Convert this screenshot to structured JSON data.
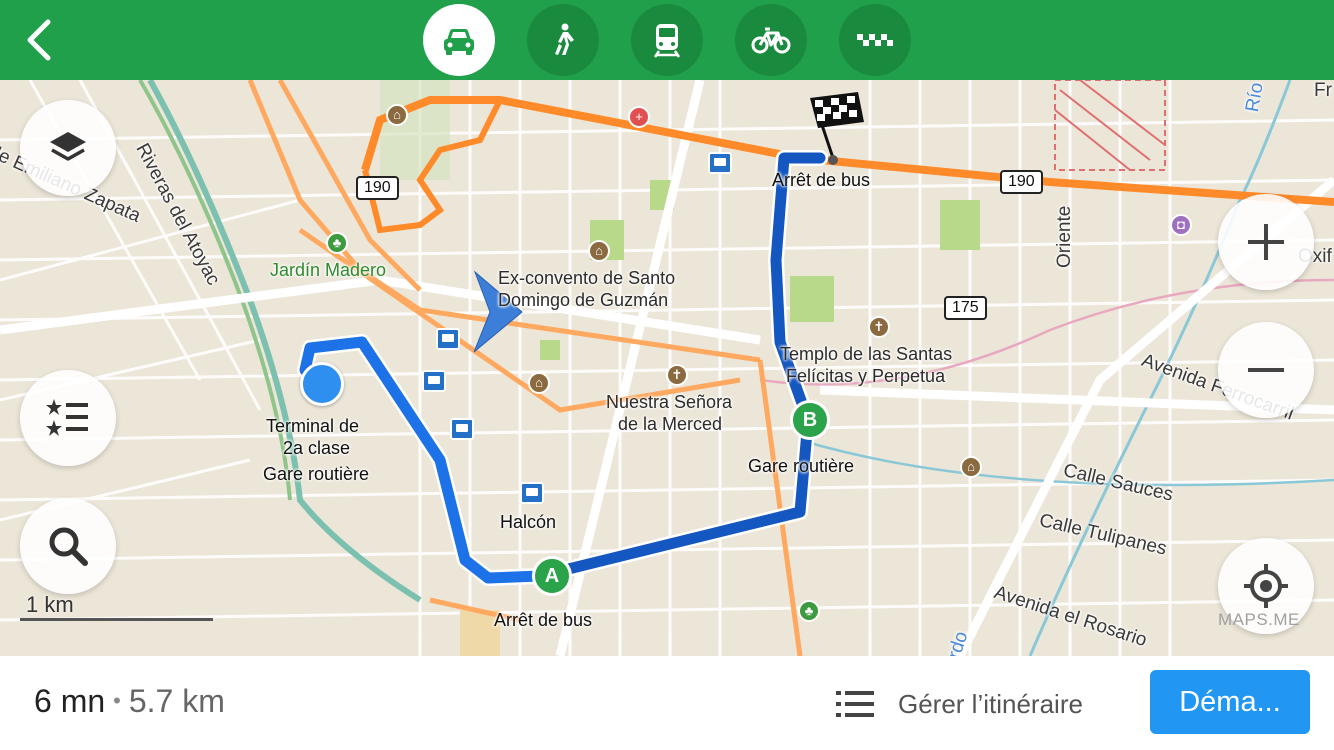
{
  "topbar": {
    "color": "#20a04a",
    "back_icon": "chevron-left-icon",
    "modes": [
      {
        "icon": "car-icon",
        "selected": true
      },
      {
        "icon": "walk-icon",
        "selected": false
      },
      {
        "icon": "train-icon",
        "selected": false
      },
      {
        "icon": "bicycle-icon",
        "selected": false
      },
      {
        "icon": "taxi-icon",
        "selected": false
      }
    ]
  },
  "map": {
    "streets": {
      "riveras": "Riveras del Atoyac",
      "emiliano": "lle Emiliano Zapata",
      "oriente": "Oriente",
      "rio": "Río",
      "fr": "Fr",
      "oxif": "Oxif",
      "ferrocarril": "Avenida Ferrocarril",
      "sauces": "Calle Sauces",
      "tulipanes": "Calle Tulipanes",
      "rosario": "Avenida el Rosario",
      "rdo": "rdo"
    },
    "road_shields": {
      "r190a": "190",
      "r190b": "190",
      "r175": "175"
    },
    "places": {
      "jardin": "Jardín Madero",
      "convento_1": "Ex-convento de Santo",
      "convento_2": "Domingo de Guzmán",
      "templo_1": "Templo de las Santas",
      "templo_2": "Felícitas y Perpetua",
      "merced_1": "Nuestra Señora",
      "merced_2": "de la Merced",
      "terminal_1": "Terminal de",
      "terminal_2": "2a clase",
      "terminal_3": "Gare routière",
      "halcon": "Halcón",
      "arret_top": "Arrêt de bus",
      "arret_bottom": "Arrêt de bus",
      "gare_b": "Gare routière"
    },
    "route_points": {
      "a": "A",
      "b": "B"
    },
    "route_color": "#1d72e8",
    "route_color_transit": "#1557c0",
    "highway_color": "#ff8a2a",
    "scale_label": "1 km",
    "watermark": "MAPS.ME",
    "controls": [
      "layers-icon",
      "bookmarks-icon",
      "search-icon",
      "zoom-in-icon",
      "zoom-out-icon",
      "my-location-icon"
    ]
  },
  "bottombar": {
    "eta_time": "6 mn",
    "eta_separator": "•",
    "eta_distance": "5.7 km",
    "manage_label": "Gérer l’itinéraire",
    "start_label": "Déma...",
    "start_color": "#2196f3"
  }
}
